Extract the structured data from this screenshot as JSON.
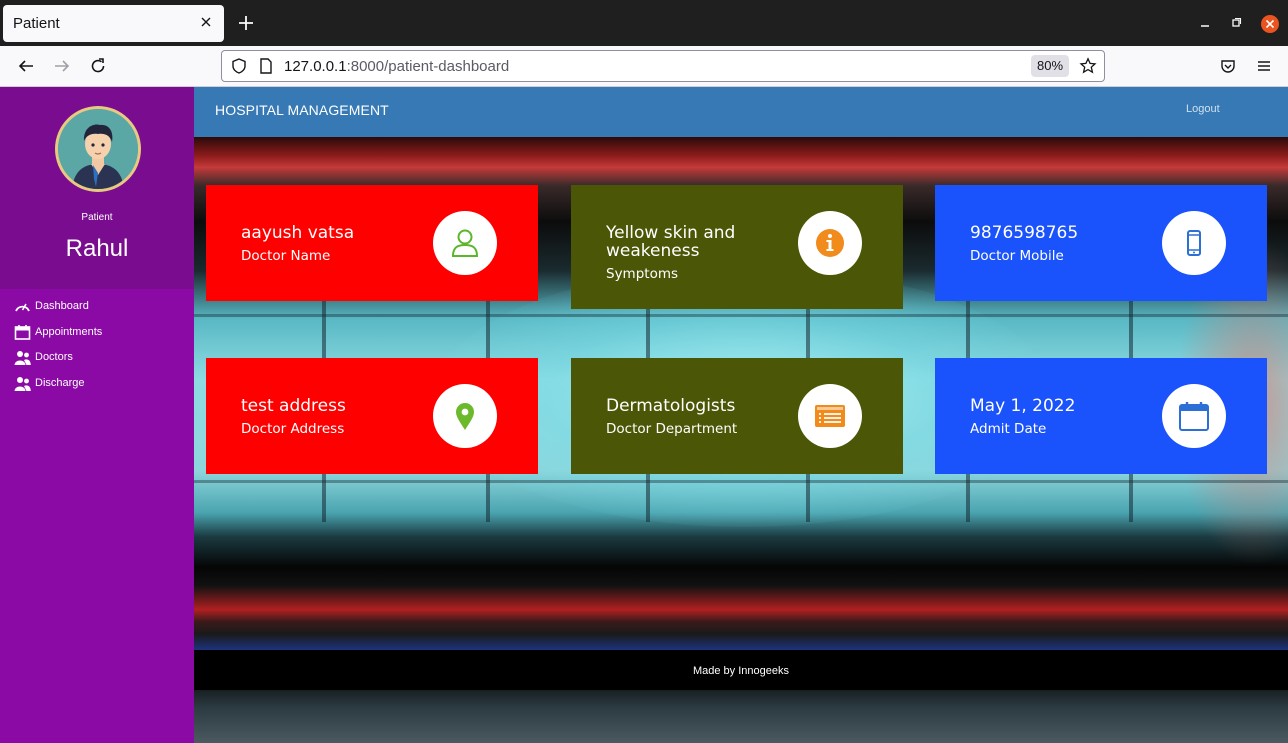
{
  "browser": {
    "tab_title": "Patient",
    "url_host": "127.0.0.1",
    "url_path": ":8000/patient-dashboard",
    "zoom": "80%"
  },
  "sidebar": {
    "role": "Patient",
    "username": "Rahul",
    "items": [
      {
        "label": "Dashboard",
        "icon": "gauge-icon"
      },
      {
        "label": "Appointments",
        "icon": "calendar-icon"
      },
      {
        "label": "Doctors",
        "icon": "users-icon"
      },
      {
        "label": "Discharge",
        "icon": "users-icon"
      }
    ]
  },
  "header": {
    "brand": "HOSPITAL MANAGEMENT",
    "logout": "Logout"
  },
  "cards": [
    {
      "value": "aayush vatsa",
      "label": "Doctor Name",
      "color": "#ff0000",
      "icon": "user-icon"
    },
    {
      "value": "Yellow skin and weakeness",
      "label": "Symptoms",
      "color": "#4b5706",
      "icon": "info-icon"
    },
    {
      "value": "9876598765",
      "label": "Doctor Mobile",
      "color": "#1a52fb",
      "icon": "mobile-icon"
    },
    {
      "value": "test address",
      "label": "Doctor Address",
      "color": "#ff0000",
      "icon": "map-pin-icon"
    },
    {
      "value": "Dermatologists",
      "label": "Doctor Department",
      "color": "#4b5706",
      "icon": "list-icon"
    },
    {
      "value": "May 1, 2022",
      "label": "Admit Date",
      "color": "#1a52fb",
      "icon": "calendar-icon"
    }
  ],
  "footer": {
    "text": "Made by Innogeeks"
  }
}
